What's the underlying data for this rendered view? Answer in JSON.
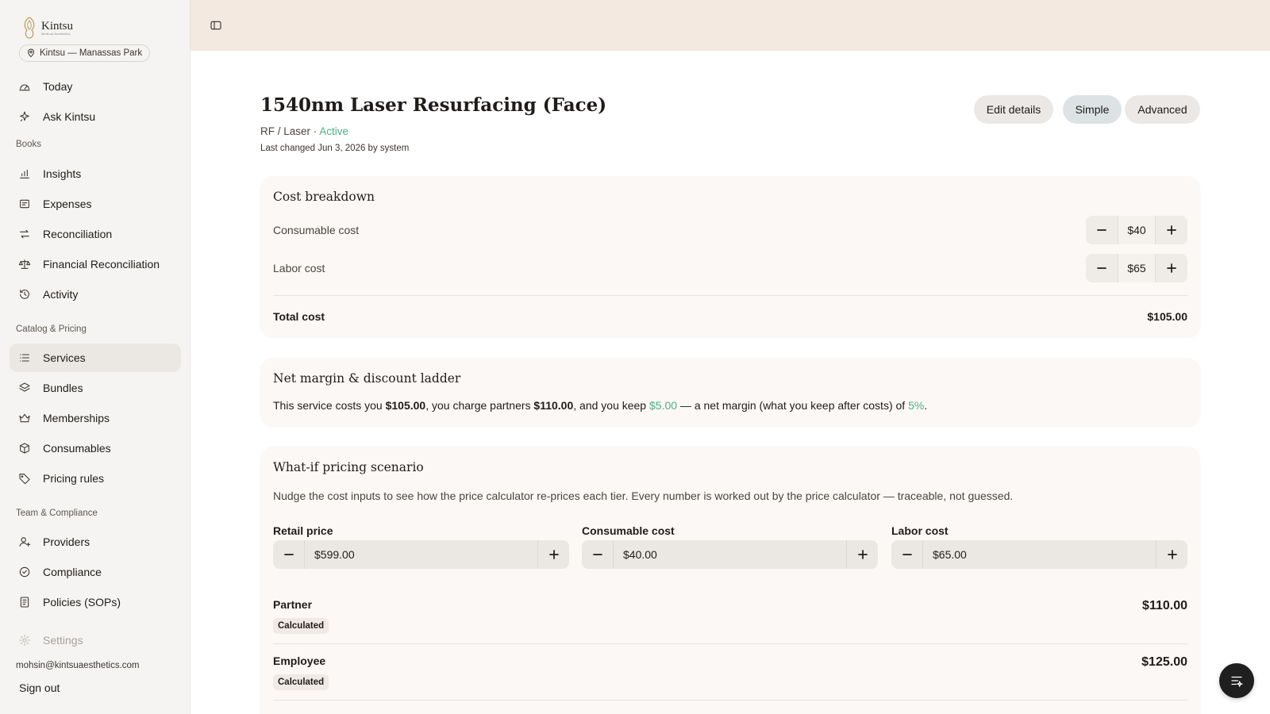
{
  "brand": {
    "name": "Kintsu",
    "tagline": "Medical Aesthetics"
  },
  "location": {
    "label": "Kintsu — Manassas Park"
  },
  "nav": {
    "top": [
      {
        "label": "Today",
        "icon": "gauge-icon"
      },
      {
        "label": "Ask Kintsu",
        "icon": "sparkle-icon"
      }
    ],
    "books_label": "Books",
    "books": [
      {
        "label": "Insights",
        "icon": "bar-chart-icon"
      },
      {
        "label": "Expenses",
        "icon": "receipt-icon"
      },
      {
        "label": "Reconciliation",
        "icon": "arrows-swap-icon"
      },
      {
        "label": "Financial Reconciliation",
        "icon": "scale-icon"
      },
      {
        "label": "Activity",
        "icon": "history-icon"
      }
    ],
    "catalog_label": "Catalog & Pricing",
    "catalog": [
      {
        "label": "Services",
        "icon": "list-icon",
        "active": true
      },
      {
        "label": "Bundles",
        "icon": "layers-icon"
      },
      {
        "label": "Memberships",
        "icon": "crown-icon"
      },
      {
        "label": "Consumables",
        "icon": "package-icon"
      },
      {
        "label": "Pricing rules",
        "icon": "tag-icon"
      }
    ],
    "team_label": "Team & Compliance",
    "team": [
      {
        "label": "Providers",
        "icon": "user-plus-icon"
      },
      {
        "label": "Compliance",
        "icon": "badge-check-icon"
      },
      {
        "label": "Policies (SOPs)",
        "icon": "document-icon"
      }
    ],
    "settings": {
      "label": "Settings",
      "icon": "gear-icon"
    }
  },
  "user": {
    "email": "mohsin@kintsuaesthetics.com",
    "signout_label": "Sign out"
  },
  "header": {
    "title": "1540nm Laser Resurfacing (Face)",
    "category": "RF / Laser",
    "separator": " · ",
    "status": "Active",
    "last_changed": "Last changed Jun 3, 2026 by system",
    "edit_label": "Edit details",
    "simple_label": "Simple",
    "advanced_label": "Advanced"
  },
  "cost_breakdown": {
    "title": "Cost breakdown",
    "consumable_label": "Consumable cost",
    "consumable_value": "$40",
    "labor_label": "Labor cost",
    "labor_value": "$65",
    "total_label": "Total cost",
    "total_value": "$105.00"
  },
  "net_margin": {
    "title": "Net margin & discount ladder",
    "t1": "This service costs you ",
    "cost": "$105.00",
    "t2": ", you charge partners ",
    "partner_price": "$110.00",
    "t3": ", and you keep ",
    "keep": "$5.00",
    "t4": " — a net margin (what you keep after costs) of ",
    "margin": "5%",
    "t5": "."
  },
  "what_if": {
    "title": "What-if pricing scenario",
    "description": "Nudge the cost inputs to see how the price calculator re-prices each tier. Every number is worked out by the price calculator — traceable, not guessed.",
    "retail_label": "Retail price",
    "retail_value": "$599.00",
    "consumable_label": "Consumable cost",
    "consumable_value": "$40.00",
    "labor_label": "Labor cost",
    "labor_value": "$65.00",
    "tiers": [
      {
        "name": "Partner",
        "badge": "Calculated",
        "price": "$110.00"
      },
      {
        "name": "Employee",
        "badge": "Calculated",
        "price": "$125.00"
      }
    ]
  },
  "colors": {
    "accent_green": "#4caf8a",
    "topbar": "#f3e9e1",
    "sidebar": "#f6f4f2",
    "card": "#fbf8f5"
  }
}
